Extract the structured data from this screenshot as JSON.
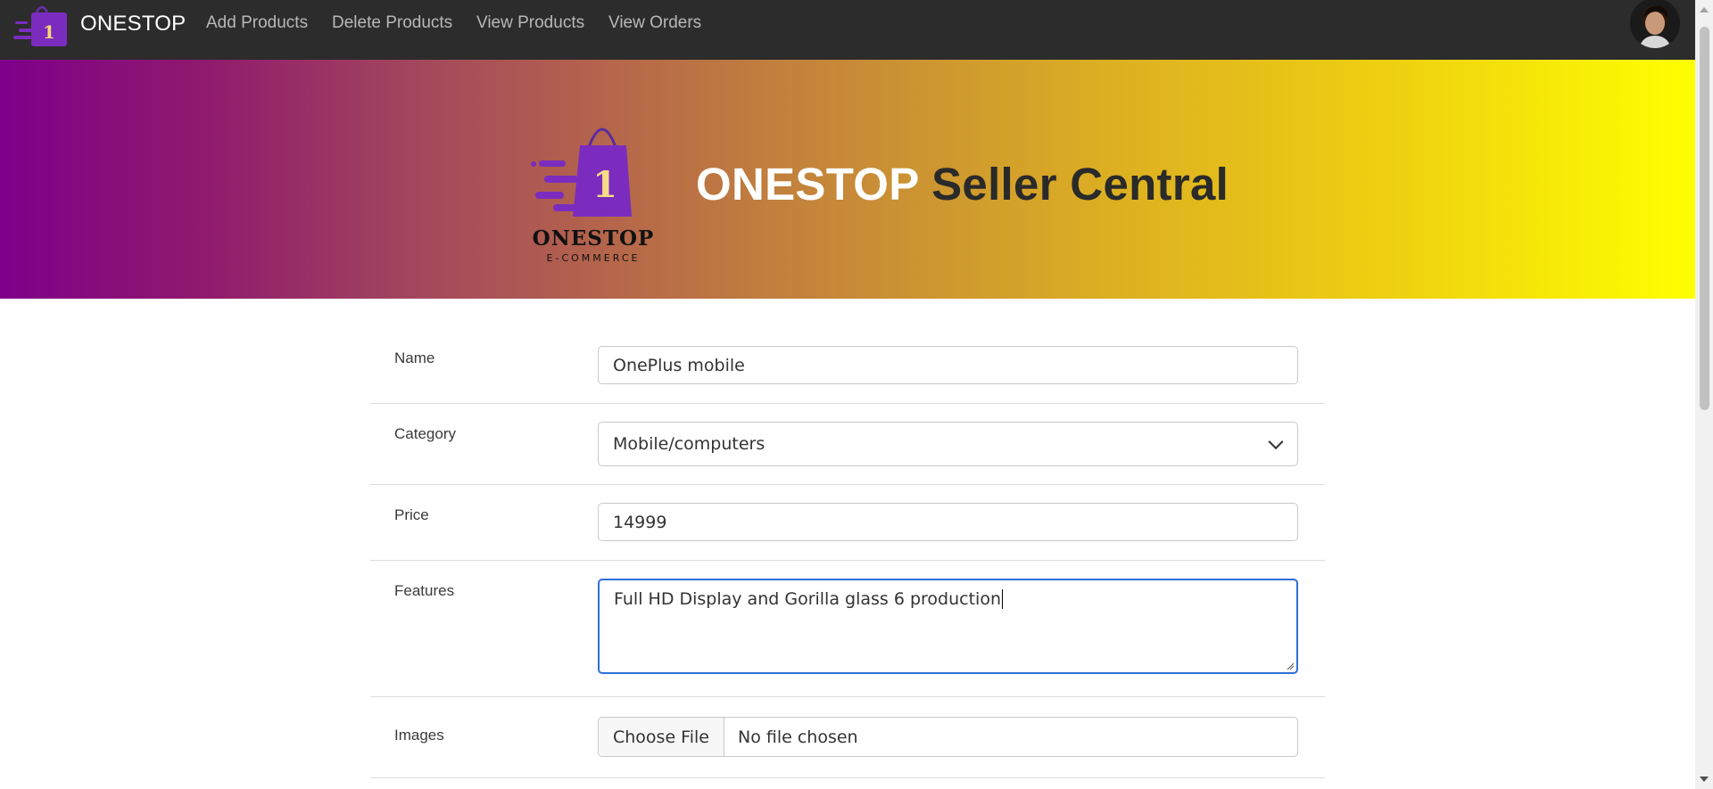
{
  "navbar": {
    "brand": "ONESTOP",
    "links": [
      "Add Products",
      "Delete Products",
      "View Products",
      "View Orders"
    ]
  },
  "hero": {
    "logo_name": "ONESTOP",
    "logo_tagline": "E-COMMERCE",
    "logo_badge": "1",
    "title_strong": "ONESTOP",
    "title_rest": " Seller Central"
  },
  "form": {
    "name": {
      "label": "Name",
      "value": "OnePlus mobile"
    },
    "category": {
      "label": "Category",
      "value": "Mobile/computers"
    },
    "price": {
      "label": "Price",
      "value": "14999"
    },
    "features": {
      "label": "Features",
      "value": "Full HD Display and Gorilla glass 6 production"
    },
    "images": {
      "label": "Images",
      "button": "Choose File",
      "status": "No file chosen"
    }
  },
  "colors": {
    "navbar_bg": "#2c2c2c",
    "gradient_start": "#7e008a",
    "gradient_end": "#ffff00",
    "brand_purple": "#7b2cbf",
    "focus_border": "#2f6fd6"
  }
}
